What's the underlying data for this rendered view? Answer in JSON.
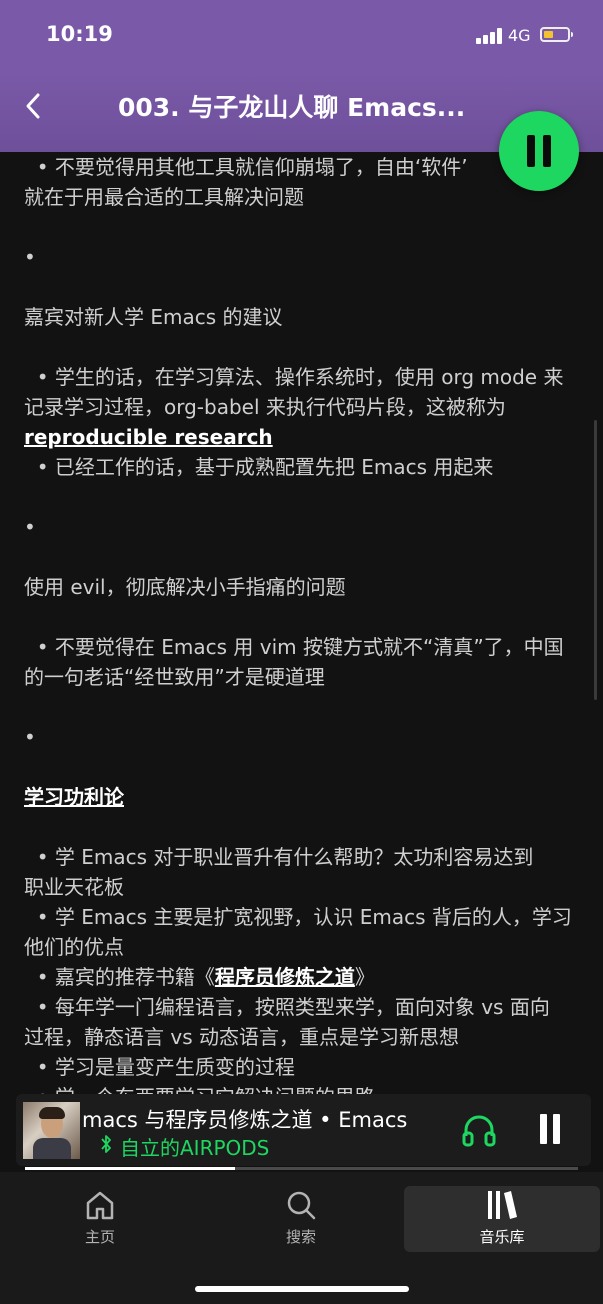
{
  "status_bar": {
    "time": "10:19",
    "network": "4G"
  },
  "header": {
    "title": "003. 与子龙山人聊 Emacs..."
  },
  "article": {
    "lines": [
      {
        "text": "  • 不要觉得用其他工具就信仰崩塌了，自由‘软件’",
        "type": "text"
      },
      {
        "text": "就在于用最合适的工具解决问题",
        "type": "text"
      },
      {
        "text": "",
        "type": "gap"
      },
      {
        "text": "•",
        "type": "text"
      },
      {
        "text": "",
        "type": "gap"
      },
      {
        "text": "嘉宾对新人学 Emacs 的建议",
        "type": "text"
      },
      {
        "text": "",
        "type": "gap"
      },
      {
        "text": "  • 学生的话，在学习算法、操作系统时，使用 org mode 来",
        "type": "text"
      },
      {
        "text": "记录学习过程，org-babel 来执行代码片段，这被称为",
        "type": "text"
      },
      {
        "text": "reproducible research",
        "type": "link"
      },
      {
        "text": "  • 已经工作的话，基于成熟配置先把 Emacs 用起来",
        "type": "text"
      },
      {
        "text": "",
        "type": "gap"
      },
      {
        "text": "•",
        "type": "text"
      },
      {
        "text": "",
        "type": "gap"
      },
      {
        "text": "使用 evil，彻底解决小手指痛的问题",
        "type": "text"
      },
      {
        "text": "",
        "type": "gap"
      },
      {
        "text": "  • 不要觉得在 Emacs 用 vim 按键方式就不“清真”了，中国",
        "type": "text"
      },
      {
        "text": "的一句老话“经世致用”才是硬道理",
        "type": "text"
      },
      {
        "text": "",
        "type": "gap"
      },
      {
        "text": "•",
        "type": "text"
      },
      {
        "text": "",
        "type": "gap"
      },
      {
        "text": "学习功利论",
        "type": "link"
      },
      {
        "text": "",
        "type": "gap"
      },
      {
        "text": "  • 学 Emacs 对于职业晋升有什么帮助？太功利容易达到",
        "type": "text"
      },
      {
        "text": "职业天花板",
        "type": "text"
      },
      {
        "text": "  • 学 Emacs 主要是扩宽视野，认识 Emacs 背后的人，学习",
        "type": "text"
      },
      {
        "text": "他们的优点",
        "type": "text"
      },
      {
        "text": "  • 嘉宾的推荐书籍《",
        "type": "book",
        "link": "程序员修炼之道",
        "after": "》"
      },
      {
        "text": "  • 每年学一门编程语言，按照类型来学，面向对象 vs 面向",
        "type": "text"
      },
      {
        "text": "过程，静态语言 vs 动态语言，重点是学习新思想",
        "type": "text"
      },
      {
        "text": "  • 学习是量变产生质变的过程",
        "type": "text"
      },
      {
        "text": "  • 学一个东西要学习它解决问题的思路",
        "type": "text"
      }
    ]
  },
  "mini_player": {
    "track_title": "macs 与程序员修炼之道 • Emacs",
    "device": "自立的AIRPODS",
    "progress": 0.38
  },
  "tabs": [
    {
      "label": "主页",
      "icon": "home-icon"
    },
    {
      "label": "搜索",
      "icon": "search-icon"
    },
    {
      "label": "音乐库",
      "icon": "library-icon"
    }
  ],
  "colors": {
    "accent": "#1ed760",
    "header": "#7a5aa8",
    "background": "#121212"
  }
}
